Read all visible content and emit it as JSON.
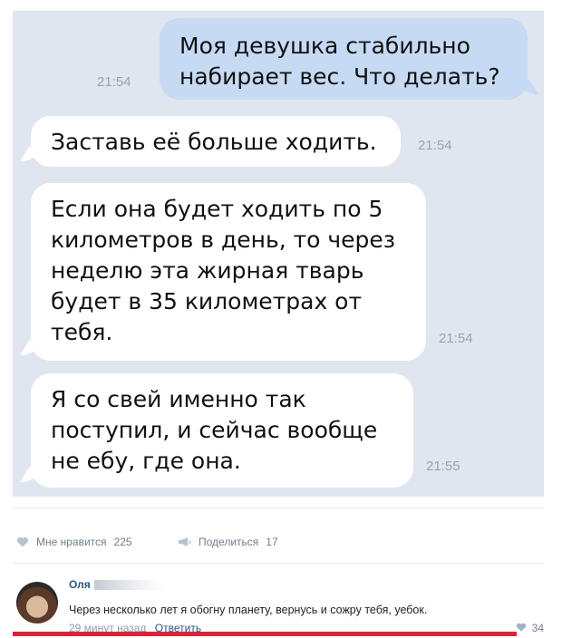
{
  "messages": [
    {
      "direction": "outgoing",
      "text": "Моя девушка стабильно набирает вес. Что делать?",
      "time": "21:54"
    },
    {
      "direction": "incoming",
      "text": "Заставь её больше ходить.",
      "time": "21:54"
    },
    {
      "direction": "incoming",
      "text": "Если она будет ходить по 5 километров в день, то через неделю эта жирная тварь будет в 35 километрах от тебя.",
      "time": "21:54"
    },
    {
      "direction": "incoming",
      "text": "Я со свей именно так поступил, и сейчас вообще не ебу, где она.",
      "time": "21:55"
    }
  ],
  "actions": {
    "like_label": "Мне нравится",
    "like_count": "225",
    "share_label": "Поделиться",
    "share_count": "17"
  },
  "comment": {
    "author": "Оля",
    "text": "Через несколько лет я обогну планету, вернусь и сожру тебя, уебок.",
    "time": "29 минут назад",
    "reply_label": "Ответить",
    "likes": "34"
  },
  "colors": {
    "chat_background": "#dfe6f0",
    "outgoing_bubble": "#c6daf3",
    "incoming_bubble": "#ffffff",
    "link": "#2a5885",
    "underline_mark": "#d9253a"
  }
}
